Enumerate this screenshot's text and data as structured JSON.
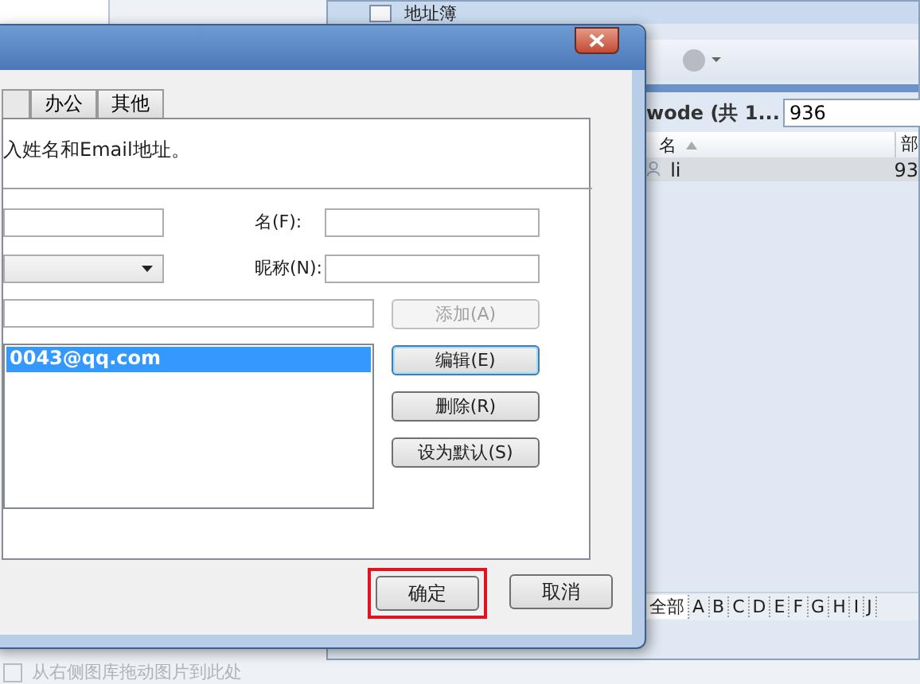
{
  "back_window": {
    "title": "地址簿",
    "search_label": "wode (共 1...",
    "search_value": "936",
    "columns": [
      {
        "label": "名",
        "sorted": true
      },
      {
        "label": "部"
      }
    ],
    "rows": [
      {
        "cells": [
          "li",
          "93"
        ],
        "selected": true
      }
    ],
    "alphabet": [
      {
        "label": "全部",
        "selected": true
      },
      {
        "label": "A",
        "selected": false
      },
      {
        "label": "B",
        "selected": false
      },
      {
        "label": "C",
        "selected": false
      },
      {
        "label": "D",
        "selected": false
      },
      {
        "label": "E",
        "selected": false
      },
      {
        "label": "F",
        "selected": false
      },
      {
        "label": "G",
        "selected": false
      },
      {
        "label": "H",
        "selected": false
      },
      {
        "label": "I",
        "selected": false
      },
      {
        "label": "J",
        "selected": false
      }
    ],
    "status": "从右侧图库拖动图片到此处"
  },
  "dialog": {
    "tabs": [
      {
        "label": "办公",
        "selected": false
      },
      {
        "label": "其他",
        "selected": false
      }
    ],
    "intro": "入姓名和Email地址。",
    "first_name_label": "名(F):",
    "nickname_label": "昵称(N):",
    "emails": [
      {
        "text": "0043@qq.com",
        "selected": true
      }
    ],
    "side_buttons": [
      {
        "label": "添加(A)",
        "disabled": true,
        "focused": false
      },
      {
        "label": "编辑(E)",
        "disabled": false,
        "focused": true
      },
      {
        "label": "删除(R)",
        "disabled": false,
        "focused": false
      },
      {
        "label": "设为默认(S)",
        "disabled": false,
        "focused": false
      }
    ],
    "ok": {
      "label": "确定",
      "highlighted": true
    },
    "cancel": "取消"
  }
}
